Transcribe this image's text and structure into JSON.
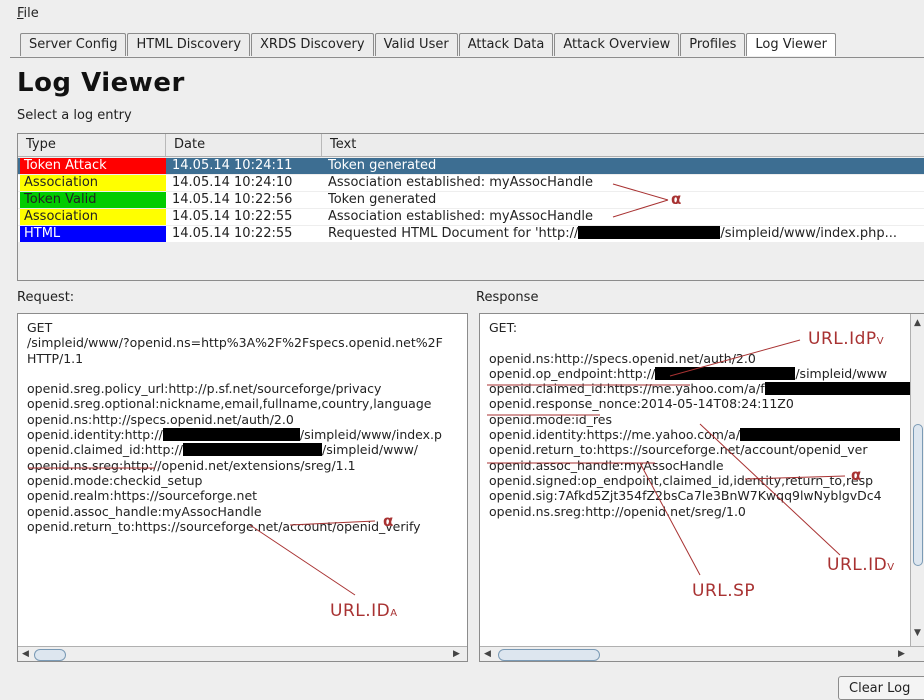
{
  "menu": {
    "file": "File",
    "file_mnemonic": "F",
    "file_rest": "ile"
  },
  "tabs": [
    "Server Config",
    "HTML Discovery",
    "XRDS Discovery",
    "Valid User",
    "Attack Data",
    "Attack Overview",
    "Profiles",
    "Log Viewer"
  ],
  "active_tab": "Log Viewer",
  "page": {
    "title": "Log Viewer",
    "subtitle": "Select a log entry"
  },
  "table": {
    "headers": [
      "Type",
      "Date",
      "Text"
    ],
    "rows": [
      {
        "type": "Token Attack",
        "type_color": "#ff0000",
        "type_text_color": "#ffffff",
        "date": "14.05.14 10:24:11",
        "text": "Token generated",
        "selected": true
      },
      {
        "type": "Association",
        "type_color": "#ffff00",
        "type_text_color": "#222222",
        "date": "14.05.14 10:24:10",
        "text": "Association established: myAssocHandle",
        "selected": false
      },
      {
        "type": "Token Valid",
        "type_color": "#00cc00",
        "type_text_color": "#222222",
        "date": "14.05.14 10:22:56",
        "text": "Token generated",
        "selected": false
      },
      {
        "type": "Association",
        "type_color": "#ffff00",
        "type_text_color": "#222222",
        "date": "14.05.14 10:22:55",
        "text": "Association established: myAssocHandle",
        "selected": false
      },
      {
        "type": "HTML",
        "type_color": "#0000ff",
        "type_text_color": "#ffffff",
        "date": "14.05.14 10:22:55",
        "text_before": "Requested HTML Document for 'http://",
        "text_after": "/simpleid/www/index.php...",
        "selected": false
      }
    ]
  },
  "request": {
    "label": "Request:",
    "lines": [
      "GET",
      "/simpleid/www/?openid.ns=http%3A%2F%2Fspecs.openid.net%2F",
      " HTTP/1.1",
      "",
      "openid.sreg.policy_url:http://p.sf.net/sourceforge/privacy",
      "openid.sreg.optional:nickname,email,fullname,country,language",
      "openid.ns:http://specs.openid.net/auth/2.0",
      "openid.identity:http://",
      "openid.claimed_id:http://",
      "openid.ns.sreg:http://openid.net/extensions/sreg/1.1",
      "openid.mode:checkid_setup",
      "openid.realm:https://sourceforge.net",
      "openid.assoc_handle:myAssocHandle",
      "openid.return_to:https://sourceforge.net/account/openid_verify"
    ],
    "identity_suffix": "/simpleid/www/index.p",
    "claimed_suffix": "/simpleid/www/"
  },
  "response": {
    "label": "Response",
    "lines": [
      "GET:",
      "",
      "openid.ns:http://specs.openid.net/auth/2.0",
      "openid.op_endpoint:http://",
      "openid.claimed_id:https://me.yahoo.com/a/",
      "openid.response_nonce:2014-05-14T08:24:11Z0",
      "openid.mode:id_res",
      "openid.identity:https://me.yahoo.com/a/",
      "openid.return_to:https://sourceforge.net/account/openid_ver",
      "openid.assoc_handle:myAssocHandle",
      "openid.signed:op_endpoint,claimed_id,identity,return_to,resp",
      "openid.sig:7Afkd5Zjt354fZ2bsCa7le3BnW7Kwqq9lwNyblgvDc4",
      "openid.ns.sreg:http://openid.net/sreg/1.0"
    ],
    "endpoint_suffix": "/simpleid/www",
    "claimed_suffix": "f"
  },
  "annotations": {
    "alpha": "α",
    "url_idp": "URL.IdP",
    "url_idp_sub": "V",
    "url_idv": "URL.ID",
    "url_idv_sub": "V",
    "url_sp": "URL.SP",
    "url_ida": "URL.ID",
    "url_ida_sub": "A"
  },
  "buttons": {
    "clear_log": "Clear Log"
  },
  "colors": {
    "selected_row": "#3d6e92",
    "annotation": "#a83232"
  }
}
